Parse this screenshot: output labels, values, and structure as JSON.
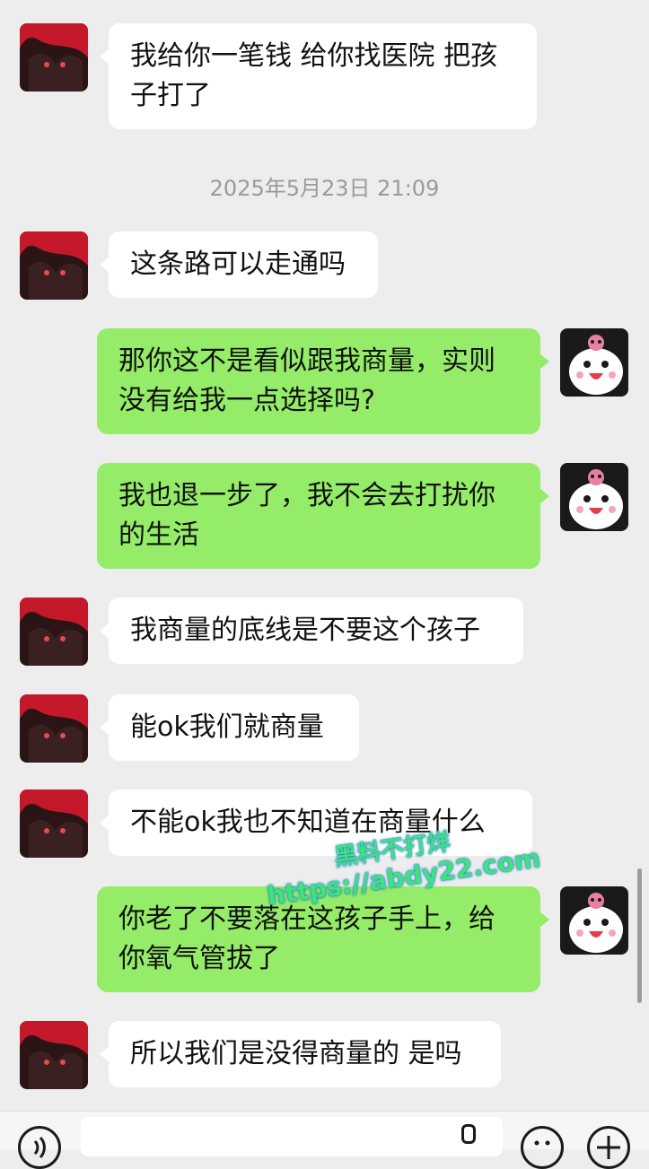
{
  "messages": [
    {
      "side": "in",
      "text": "我给你一笔钱 给你找医院 把孩\n子打了"
    },
    {
      "side": "in",
      "text": "这条路可以走通吗"
    },
    {
      "side": "out",
      "text": "那你这不是看似跟我商量，实则\n没有给我一点选择吗?"
    },
    {
      "side": "out",
      "text": "我也退一步了，我不会去打扰你\n的生活"
    },
    {
      "side": "in",
      "text": "我商量的底线是不要这个孩子"
    },
    {
      "side": "in",
      "text": "能ok我们就商量"
    },
    {
      "side": "in",
      "text": "不能ok我也不知道在商量什么"
    },
    {
      "side": "out",
      "text": "你老了不要落在这孩子手上，给\n你氧气管拔了"
    },
    {
      "side": "in",
      "text": "所以我们是没得商量的 是吗"
    }
  ],
  "timestamp": "2025年5月23日 21:09",
  "watermark": {
    "line1": "黑料不打烊",
    "line2": "https://abdy22.com"
  },
  "colors": {
    "incoming_bubble": "#ffffff",
    "outgoing_bubble": "#95ec69",
    "background": "#ededed"
  },
  "input_bar": {
    "left_icon": "voice-icon",
    "right_icons": [
      "emoji-icon",
      "plus-icon"
    ]
  }
}
